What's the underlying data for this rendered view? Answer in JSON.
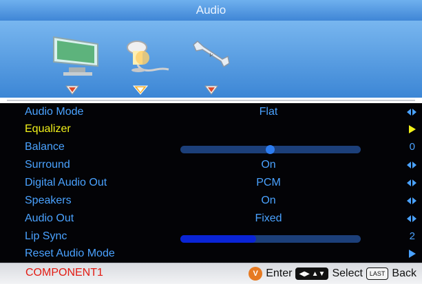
{
  "window": {
    "title": "Audio"
  },
  "icons": [
    {
      "name": "picture-icon",
      "active": false
    },
    {
      "name": "audio-icon",
      "active": true
    },
    {
      "name": "settings-icon",
      "active": false
    }
  ],
  "menu": {
    "items": [
      {
        "label": "Audio Mode",
        "type": "select",
        "value": "Flat",
        "right": ""
      },
      {
        "label": "Equalizer",
        "type": "submenu",
        "value": "",
        "right": "",
        "selected": true
      },
      {
        "label": "Balance",
        "type": "balance",
        "value": "",
        "right": "0",
        "level": 0.5
      },
      {
        "label": "Surround",
        "type": "select",
        "value": "On",
        "right": ""
      },
      {
        "label": "Digital Audio Out",
        "type": "select",
        "value": "PCM",
        "right": ""
      },
      {
        "label": "Speakers",
        "type": "select",
        "value": "On",
        "right": ""
      },
      {
        "label": "Audio Out",
        "type": "select",
        "value": "Fixed",
        "right": ""
      },
      {
        "label": "Lip Sync",
        "type": "slider",
        "value": "",
        "right": "2",
        "level": 0.42
      },
      {
        "label": "Reset Audio Mode",
        "type": "submenu",
        "value": "",
        "right": ""
      }
    ]
  },
  "footer": {
    "input": "COMPONENT1",
    "enter_label": "Enter",
    "select_label": "Select",
    "back_label": "Back",
    "last_key": "LAST",
    "badge": "V"
  },
  "colors": {
    "label": "#4aa2ff",
    "selected": "#f2f21a",
    "input_name": "#e31a12"
  }
}
